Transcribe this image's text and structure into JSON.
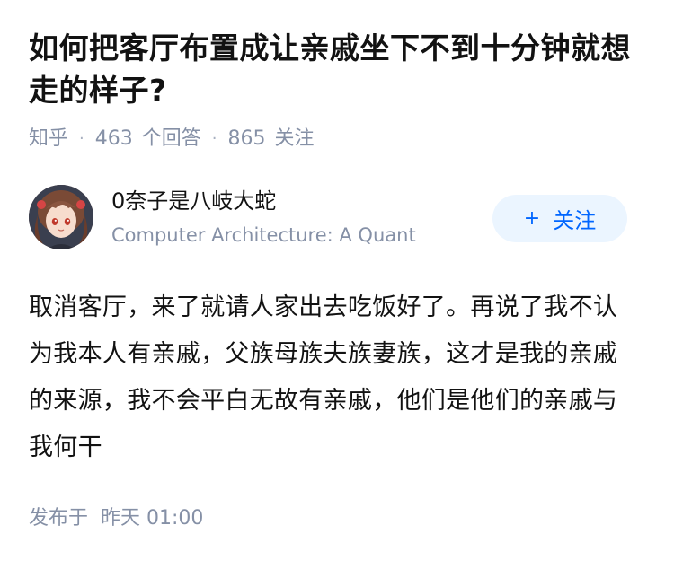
{
  "question": {
    "title": "如何把客厅布置成让亲戚坐下不到十分钟就想走的样子?",
    "source": "知乎",
    "answer_count": "463",
    "answer_label": "个回答",
    "follower_count": "865",
    "follower_label": "关注"
  },
  "answer": {
    "author_name": "0奈子是八岐大蛇",
    "author_bio": "Computer Architecture: A Quant",
    "follow_label": "关注",
    "follow_icon": "plus-icon",
    "content": "取消客厅，来了就请人家出去吃饭好了。再说了我不认为我本人有亲戚，父族母族夫族妻族，这才是我的亲戚的来源，我不会平白无故有亲戚，他们是他们的亲戚与我何干",
    "published_label": "发布于",
    "published_time": "昨天 01:00"
  },
  "colors": {
    "accent": "#0066ff",
    "accent_bg": "#ebf5ff",
    "meta_gray": "#8590a6",
    "text": "#121212"
  }
}
